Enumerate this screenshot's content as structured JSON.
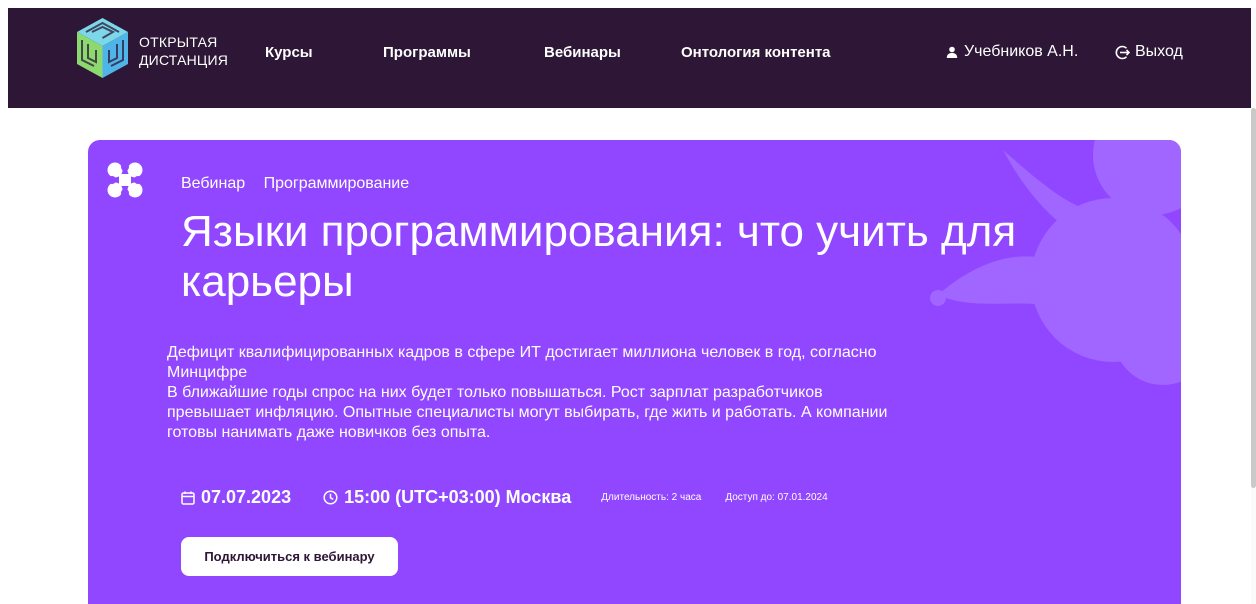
{
  "header": {
    "logo_line1": "ОТКРЫТАЯ",
    "logo_line2": "ДИСТАНЦИЯ",
    "nav": [
      {
        "label": "Курсы"
      },
      {
        "label": "Программы"
      },
      {
        "label": "Вебинары"
      },
      {
        "label": "Онтология контента"
      }
    ],
    "user_name": "Учебников А.Н.",
    "logout_label": "Выход",
    "background_color": "#2d1636"
  },
  "card": {
    "background_color": "#9146ff",
    "tags": [
      "Вебинар",
      "Программирование"
    ],
    "title": "Языки программирования: что учить для карьеры",
    "description_line1": "Дефицит квалифицированных кадров в сфере ИТ достигает миллиона человек в год, согласно Минцифре",
    "description_line2": "В ближайшие годы спрос на них будет только повышаться. Рост зарплат разработчиков превышает инфляцию. Опытные специалисты могут выбирать, где жить и работать. А компании готовы нанимать даже новичков без опыта.",
    "date": "07.07.2023",
    "time": "15:00 (UTC+03:00) Москва",
    "duration": "Длительность: 2 часа",
    "access_until": "Доступ до: 07.01.2024",
    "connect_button": "Подключиться к вебинару"
  },
  "icons": {
    "logo": "maze-cube-logo-icon",
    "user": "user-icon",
    "logout": "logout-icon",
    "card": "webinar-molecule-icon",
    "calendar": "calendar-icon",
    "clock": "clock-icon"
  }
}
